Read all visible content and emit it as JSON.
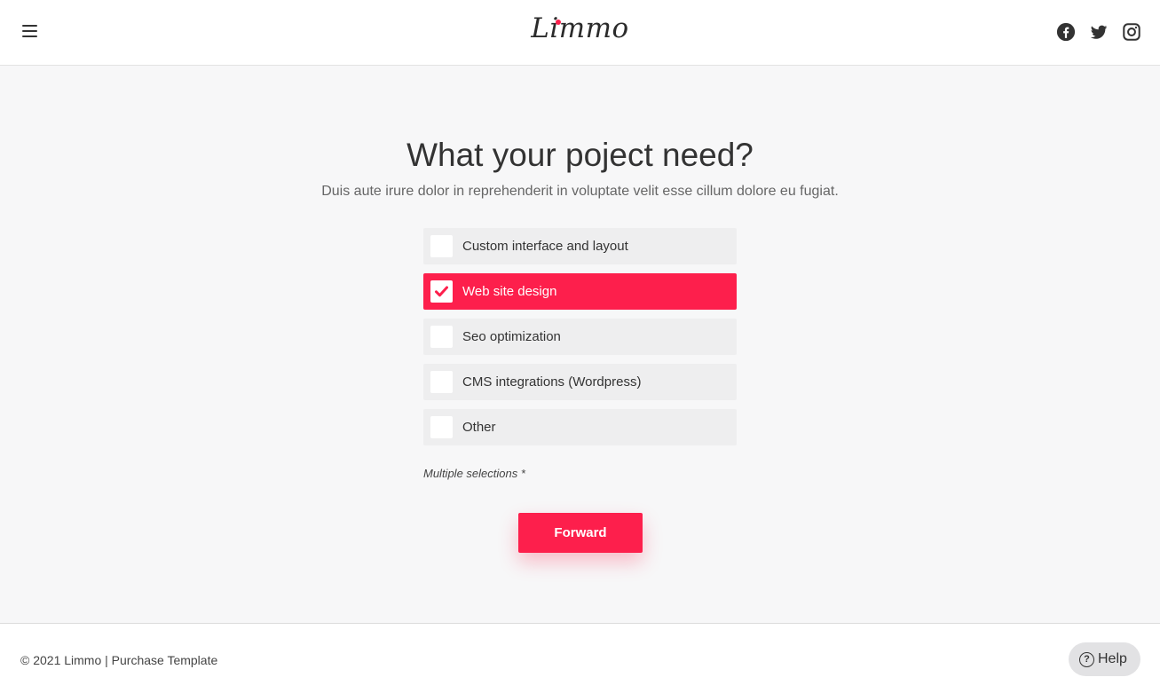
{
  "header": {
    "logo": "Limmo",
    "social": [
      "facebook-icon",
      "twitter-icon",
      "instagram-icon"
    ]
  },
  "main": {
    "title": "What your poject need?",
    "subtitle": "Duis aute irure dolor in reprehenderit in voluptate velit esse cillum dolore eu fugiat.",
    "options": [
      {
        "label": "Custom interface and layout",
        "checked": false
      },
      {
        "label": "Web site design",
        "checked": true
      },
      {
        "label": "Seo optimization",
        "checked": false
      },
      {
        "label": "CMS integrations (Wordpress)",
        "checked": false
      },
      {
        "label": "Other",
        "checked": false
      }
    ],
    "note": "Multiple selections *",
    "forward_label": "Forward"
  },
  "footer": {
    "copyright": "© 2021 Limmo | Purchase Template",
    "help_label": "Help",
    "help_icon": "?"
  },
  "colors": {
    "accent": "#fd1f4c",
    "option_bg": "#eeeeef",
    "page_bg": "#f7f7f8"
  }
}
